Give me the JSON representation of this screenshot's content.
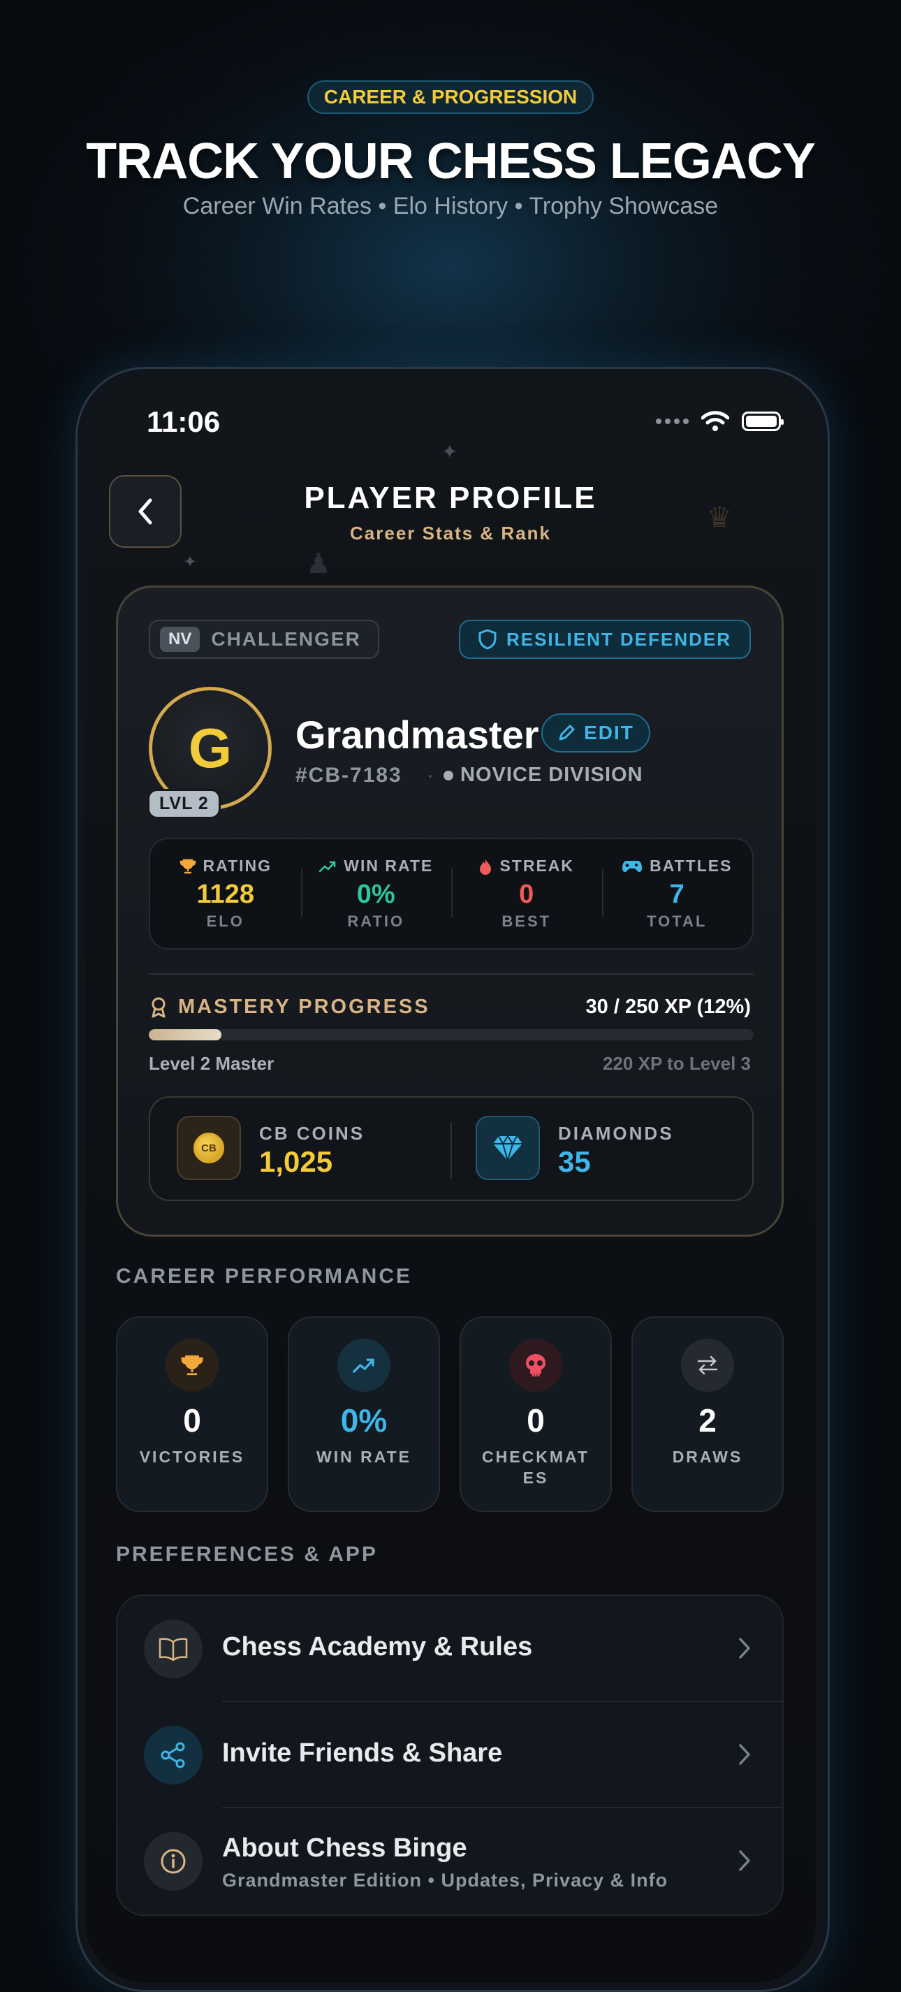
{
  "hero": {
    "pill": "CAREER & PROGRESSION",
    "title": "TRACK YOUR CHESS LEGACY",
    "subtitle": "Career Win Rates • Elo History • Trophy Showcase"
  },
  "status_bar": {
    "time": "11:06"
  },
  "header": {
    "title": "PLAYER PROFILE",
    "subtitle": "Career Stats & Rank",
    "back_icon": "chevron-left-icon"
  },
  "profile": {
    "rank_code": "NV",
    "rank_name": "CHALLENGER",
    "badge": "RESILIENT DEFENDER",
    "avatar_letter": "G",
    "level_badge": "LVL 2",
    "name": "Grandmaster",
    "edit_label": "EDIT",
    "player_id": "#CB-7183",
    "separator": "·",
    "division": "NOVICE DIVISION",
    "stats": [
      {
        "icon": "trophy-icon",
        "label": "RATING",
        "value": "1128",
        "unit": "ELO",
        "color": "#f2cb3a"
      },
      {
        "icon": "trending-up-icon",
        "label": "WIN RATE",
        "value": "0%",
        "unit": "RATIO",
        "color": "#2ec79b"
      },
      {
        "icon": "flame-icon",
        "label": "STREAK",
        "value": "0",
        "unit": "BEST",
        "color": "#ef5a5a"
      },
      {
        "icon": "gamepad-icon",
        "label": "BATTLES",
        "value": "7",
        "unit": "TOTAL",
        "color": "#3fb6e8"
      }
    ],
    "mastery": {
      "label": "MASTERY PROGRESS",
      "xp_text": "30 / 250 XP (12%)",
      "progress": 0.12,
      "level_text": "Level 2 Master",
      "next_text": "220 XP to Level 3"
    },
    "currency": {
      "coin_symbol": "CB",
      "coins_label": "CB COINS",
      "coins_value": "1,025",
      "diamonds_label": "DIAMONDS",
      "diamonds_value": "35"
    }
  },
  "career": {
    "section_label": "CAREER PERFORMANCE",
    "cards": [
      {
        "icon": "trophy-icon",
        "value": "0",
        "label": "VICTORIES",
        "color": "#ffffff"
      },
      {
        "icon": "trending-up-icon",
        "value": "0%",
        "label": "WIN RATE",
        "color": "#3fb6e8"
      },
      {
        "icon": "skull-icon",
        "value": "0",
        "label": "CHECKMATES",
        "color": "#ffffff"
      },
      {
        "icon": "swap-icon",
        "value": "2",
        "label": "DRAWS",
        "color": "#ffffff"
      }
    ]
  },
  "preferences": {
    "section_label": "PREFERENCES & APP",
    "items": [
      {
        "icon": "book-icon",
        "title": "Chess Academy & Rules"
      },
      {
        "icon": "share-icon",
        "title": "Invite Friends & Share"
      },
      {
        "icon": "info-icon",
        "title": "About Chess Binge",
        "subtitle": "Grandmaster Edition • Updates, Privacy & Info"
      }
    ]
  },
  "colors": {
    "gold": "#f2cb3a",
    "blue": "#3fb6e8",
    "green": "#2ec79b",
    "red": "#ef5a5a",
    "tan": "#d9b585"
  }
}
